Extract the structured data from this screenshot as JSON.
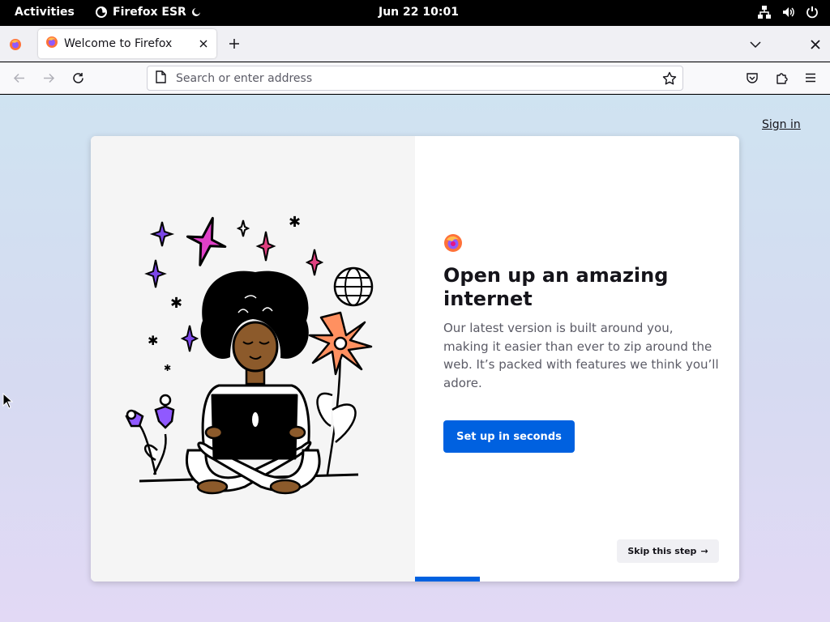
{
  "topbar": {
    "activities": "Activities",
    "app_name": "Firefox ESR",
    "clock": "Jun 22  10:01",
    "tray_icons": [
      "network-icon",
      "volume-icon",
      "power-icon"
    ]
  },
  "tabs": [
    {
      "label": "Welcome to Firefox",
      "active": true
    }
  ],
  "urlbar": {
    "placeholder": "Search or enter address",
    "value": ""
  },
  "page": {
    "signin_label": "Sign in",
    "heading": "Open up an amazing internet",
    "body": "Our latest version is built around you, making it easier than ever to zip around the web. It’s packed with features we think you’ll adore.",
    "primary_button": "Set up in seconds",
    "skip_button": "Skip this step",
    "skip_arrow": "→",
    "progress_fraction": 0.2
  },
  "colors": {
    "accent": "#0061e0",
    "topbar": "#000000",
    "tabstrip": "#f0f0f4",
    "heading": "#15141a",
    "body_text": "#5b5b66"
  }
}
